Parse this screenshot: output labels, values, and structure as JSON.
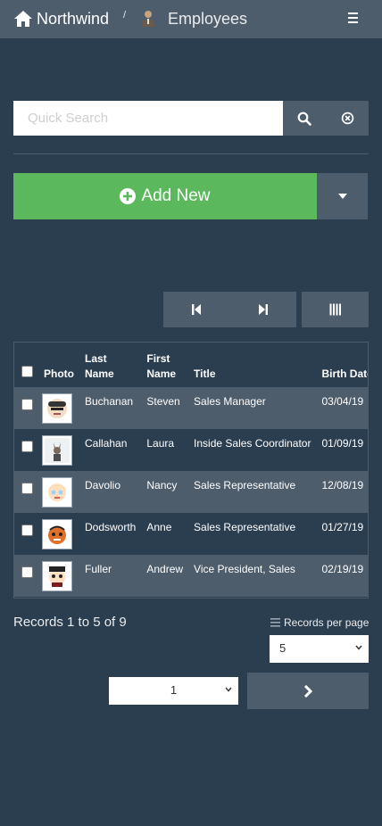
{
  "navbar": {
    "brand": "Northwind",
    "separator": "/",
    "crumb": "Employees",
    "brand_icon": "home-icon",
    "crumb_icon": "employee-icon",
    "menu_icon": "hamburger-icon"
  },
  "search": {
    "placeholder": "Quick Search",
    "value": "",
    "search_icon": "search-icon",
    "clear_icon": "clear-icon"
  },
  "actions": {
    "add_new_label": "Add New",
    "add_icon": "plus-circle-icon",
    "dropdown_icon": "caret-down-icon"
  },
  "pager_buttons": {
    "first_icon": "first-page-icon",
    "last_icon": "last-page-icon",
    "columns_icon": "columns-icon"
  },
  "table": {
    "columns": [
      "Photo",
      "Last Name",
      "First Name",
      "Title",
      "Birth Date"
    ],
    "column_lines": {
      "last": [
        "Last",
        "Name"
      ],
      "first": [
        "First",
        "Name"
      ]
    },
    "rows": [
      {
        "last": "Buchanan",
        "first": "Steven",
        "title": "Sales Manager",
        "birth": "03/04/19"
      },
      {
        "last": "Callahan",
        "first": "Laura",
        "title": "Inside Sales Coordinator",
        "birth": "01/09/19"
      },
      {
        "last": "Davolio",
        "first": "Nancy",
        "title": "Sales Representative",
        "birth": "12/08/19"
      },
      {
        "last": "Dodsworth",
        "first": "Anne",
        "title": "Sales Representative",
        "birth": "01/27/19"
      },
      {
        "last": "Fuller",
        "first": "Andrew",
        "title": "Vice President, Sales",
        "birth": "02/19/19"
      }
    ]
  },
  "footer": {
    "records_text": "Records 1 to 5 of 9",
    "records_per_page_label": "Records per page",
    "records_per_page_value": "5",
    "page_value": "1",
    "next_icon": "chevron-right-icon"
  },
  "colors": {
    "background": "#2b3e50",
    "navbar": "#4e5d6c",
    "success": "#5cb85c"
  }
}
